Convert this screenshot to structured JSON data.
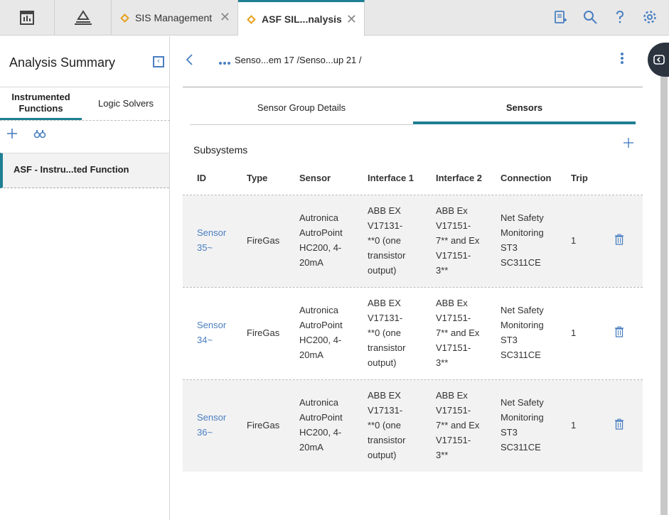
{
  "topbar": {
    "tabs": [
      {
        "label": "SIS Management"
      },
      {
        "label": "ASF SIL...nalysis"
      }
    ],
    "close_glyph": "✕"
  },
  "left": {
    "title": "Analysis Summary",
    "tabs": [
      {
        "label_line1": "Instrumented",
        "label_line2": "Functions"
      },
      {
        "label": "Logic Solvers"
      }
    ],
    "item": "ASF - Instru...ted Function"
  },
  "main": {
    "breadcrumb": "Senso...em 17 /Senso...up 21 /",
    "subtabs": [
      {
        "label": "Sensor Group Details"
      },
      {
        "label": "Sensors"
      }
    ],
    "section_title": "Subsystems",
    "columns": [
      "ID",
      "Type",
      "Sensor",
      "Interface 1",
      "Interface 2",
      "Connection",
      "Trip"
    ],
    "rows": [
      {
        "id": [
          "Sensor",
          "35~"
        ],
        "type": "FireGas",
        "sensor": [
          "Autronica",
          "AutroPoint",
          "HC200, 4-",
          "20mA"
        ],
        "interface1": [
          "ABB EX",
          "V17131-",
          "**0 (one",
          "transistor",
          "output)"
        ],
        "interface2": [
          "ABB Ex",
          "V17151-",
          "7** and Ex",
          "V17151-",
          "3**"
        ],
        "connection": [
          "Net Safety",
          "Monitoring",
          "ST3",
          "SC311CE"
        ],
        "trip": "1"
      },
      {
        "id": [
          "Sensor",
          "34~"
        ],
        "type": "FireGas",
        "sensor": [
          "Autronica",
          "AutroPoint",
          "HC200, 4-",
          "20mA"
        ],
        "interface1": [
          "ABB EX",
          "V17131-",
          "**0 (one",
          "transistor",
          "output)"
        ],
        "interface2": [
          "ABB Ex",
          "V17151-",
          "7** and Ex",
          "V17151-",
          "3**"
        ],
        "connection": [
          "Net Safety",
          "Monitoring",
          "ST3",
          "SC311CE"
        ],
        "trip": "1"
      },
      {
        "id": [
          "Sensor",
          "36~"
        ],
        "type": "FireGas",
        "sensor": [
          "Autronica",
          "AutroPoint",
          "HC200, 4-",
          "20mA"
        ],
        "interface1": [
          "ABB EX",
          "V17131-",
          "**0 (one",
          "transistor",
          "output)"
        ],
        "interface2": [
          "ABB Ex",
          "V17151-",
          "7** and Ex",
          "V17151-",
          "3**"
        ],
        "connection": [
          "Net Safety",
          "Monitoring",
          "ST3",
          "SC311CE"
        ],
        "trip": "1"
      }
    ]
  },
  "icons": {
    "dashboard": "dashboard-icon",
    "hierarchy": "pyramid-icon",
    "tab_module": "diamond-icon",
    "report": "report-icon",
    "search": "search-icon",
    "help": "help-icon",
    "settings": "gear-icon",
    "collapse": "collapse-panel-icon",
    "add": "plus-icon",
    "find": "binoculars-icon",
    "back": "chevron-left-icon",
    "more": "kebab-icon",
    "delete": "trash-icon",
    "side": "side-panel-icon"
  },
  "colors": {
    "accent": "#1e7f93",
    "link": "#4a7fc1",
    "tab_diamond": "#e6a11c"
  }
}
